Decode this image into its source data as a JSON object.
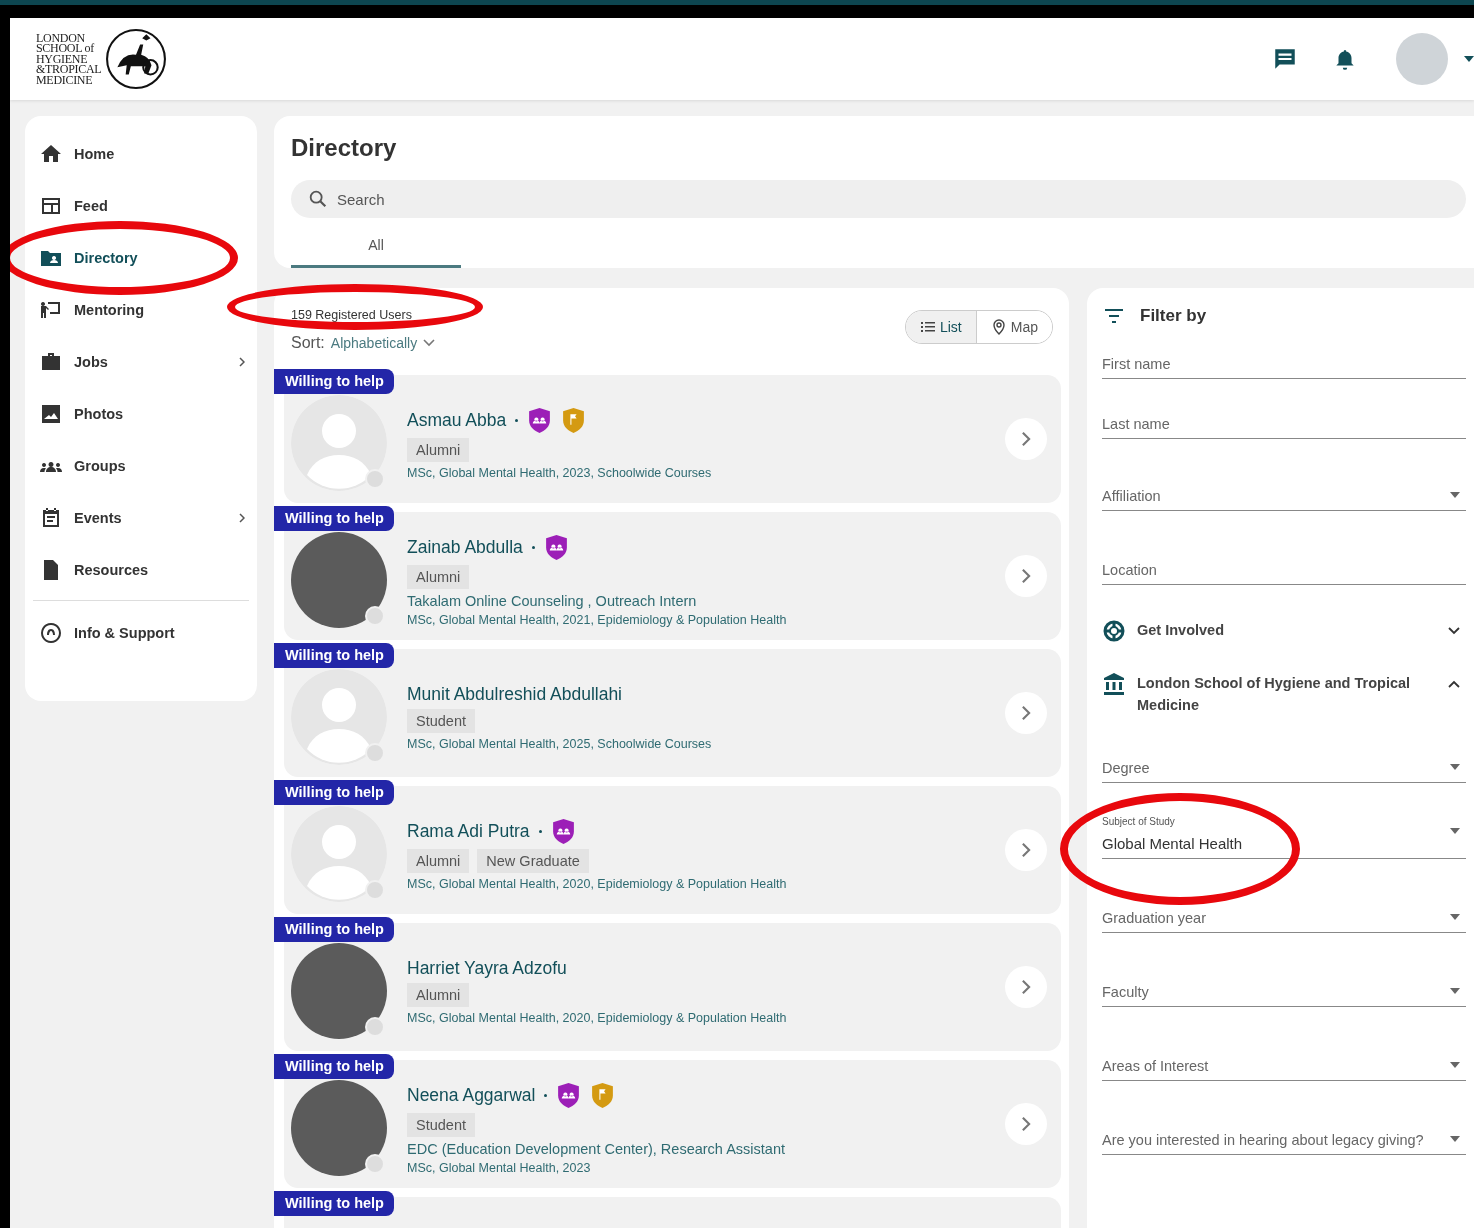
{
  "header": {
    "logo_lines": [
      "LONDON",
      "SCHOOL of",
      "HYGIENE",
      "&TROPICAL",
      "MEDICINE"
    ]
  },
  "sidebar": {
    "items": [
      {
        "label": "Home",
        "selected": false,
        "submenu": false
      },
      {
        "label": "Feed",
        "selected": false,
        "submenu": false
      },
      {
        "label": "Directory",
        "selected": true,
        "submenu": false
      },
      {
        "label": "Mentoring",
        "selected": false,
        "submenu": false
      },
      {
        "label": "Jobs",
        "selected": false,
        "submenu": true
      },
      {
        "label": "Photos",
        "selected": false,
        "submenu": false
      },
      {
        "label": "Groups",
        "selected": false,
        "submenu": false
      },
      {
        "label": "Events",
        "selected": false,
        "submenu": true
      },
      {
        "label": "Resources",
        "selected": false,
        "submenu": false
      }
    ],
    "footer_items": [
      {
        "label": "Info & Support",
        "selected": false,
        "submenu": false
      }
    ]
  },
  "directory": {
    "title": "Directory",
    "search": {
      "placeholder": "Search"
    },
    "tabs": [
      {
        "label": "All",
        "selected": true
      }
    ]
  },
  "results": {
    "count": "159 Registered Users",
    "sort_label": "Sort:",
    "sort_value": "Alphabetically",
    "views": [
      {
        "label": "List",
        "kind": "list",
        "selected": true
      },
      {
        "label": "Map",
        "kind": "map",
        "selected": false
      }
    ],
    "people": [
      {
        "badge": "Willing to help",
        "name": "Asmau Abba",
        "kind": "default",
        "awards": [
          {
            "kind": "group"
          },
          {
            "kind": "flag"
          }
        ],
        "tags": [
          "Alumni"
        ],
        "degree": "MSc, Global Mental Health, 2023, Schoolwide Courses"
      },
      {
        "badge": "Willing to help",
        "name": "Zainab Abdulla",
        "kind": "photo",
        "awards": [
          {
            "kind": "group"
          }
        ],
        "tags": [
          "Alumni"
        ],
        "detail": "Takalam Online Counseling , Outreach Intern",
        "degree": "MSc, Global Mental Health, 2021, Epidemiology & Population Health"
      },
      {
        "badge": "Willing to help",
        "name": "Munit Abdulreshid Abdullahi",
        "kind": "default",
        "tags": [
          "Student"
        ],
        "degree": "MSc, Global Mental Health, 2025, Schoolwide Courses"
      },
      {
        "badge": "Willing to help",
        "name": "Rama Adi Putra",
        "kind": "default",
        "awards": [
          {
            "kind": "group"
          }
        ],
        "tags": [
          "Alumni",
          "New Graduate"
        ],
        "degree": "MSc, Global Mental Health, 2020, Epidemiology & Population Health"
      },
      {
        "badge": "Willing to help",
        "name": "Harriet Yayra Adzofu",
        "kind": "photo",
        "tags": [
          "Alumni"
        ],
        "degree": "MSc, Global Mental Health, 2020, Epidemiology & Population Health"
      },
      {
        "badge": "Willing to help",
        "name": "Neena Aggarwal",
        "kind": "photo",
        "awards": [
          {
            "kind": "group"
          },
          {
            "kind": "flag"
          }
        ],
        "tags": [
          "Student"
        ],
        "detail": "EDC (Education Development Center), Research Assistant",
        "degree": "MSc, Global Mental Health, 2023"
      },
      {
        "badge": "Willing to help",
        "kind": "cut"
      }
    ]
  },
  "filter": {
    "title": "Filter by",
    "fields": [
      {
        "kind": "text",
        "placeholder": "First name"
      },
      {
        "kind": "text",
        "placeholder": "Last name"
      },
      {
        "kind": "select",
        "label": "Affiliation"
      },
      {
        "kind": "text",
        "placeholder": "Location"
      },
      {
        "kind": "section",
        "label": "Get Involved",
        "expanded": false
      },
      {
        "kind": "section",
        "label": "London School of Hygiene and Tropical Medicine",
        "expanded": true
      },
      {
        "kind": "select",
        "label": "Degree"
      },
      {
        "kind": "select",
        "label": "Subject of Study",
        "value": "Global Mental Health"
      },
      {
        "kind": "select",
        "label": "Graduation year"
      },
      {
        "kind": "select",
        "label": "Faculty"
      },
      {
        "kind": "select",
        "label": "Areas of Interest"
      },
      {
        "kind": "select",
        "label": "Are you interested in hearing about legacy giving?"
      }
    ]
  }
}
